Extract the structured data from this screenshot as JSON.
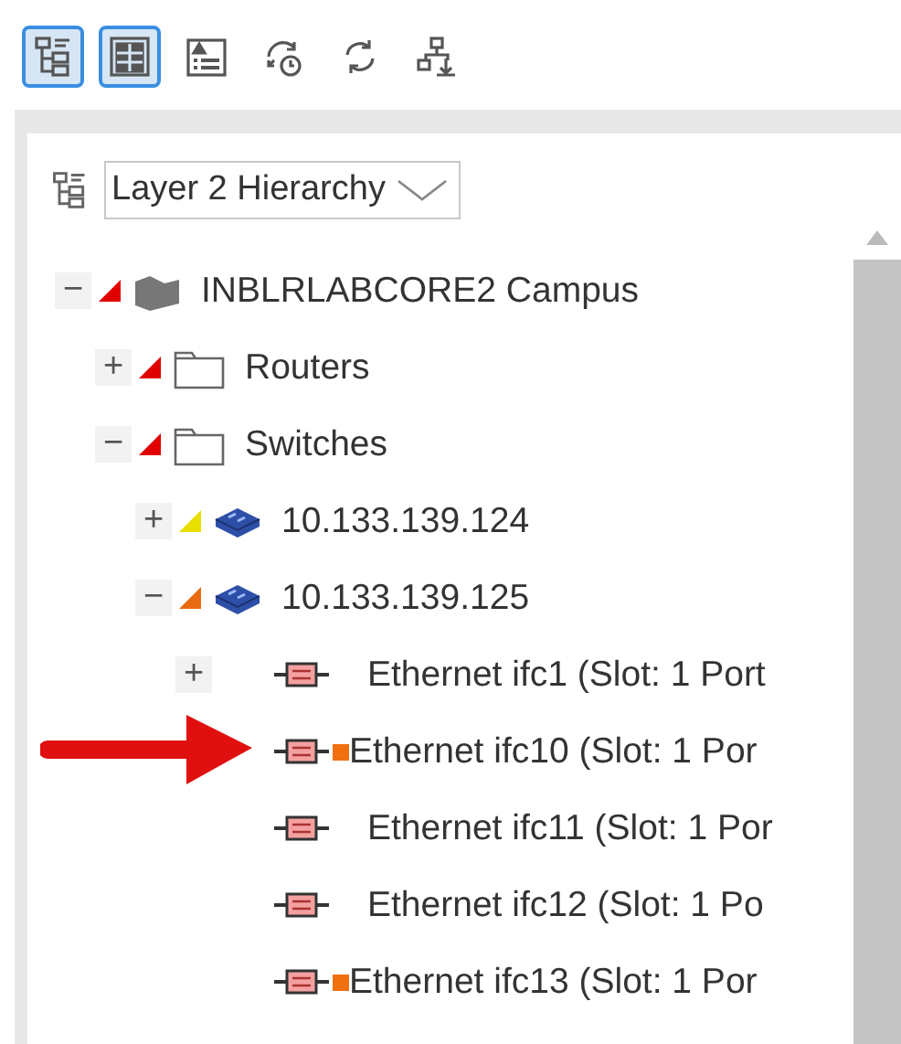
{
  "toolbar": [
    {
      "kind": "tree",
      "selected": true
    },
    {
      "kind": "grid",
      "selected": true
    },
    {
      "kind": "details",
      "selected": false
    },
    {
      "kind": "history",
      "selected": false
    },
    {
      "kind": "refresh",
      "selected": false
    },
    {
      "kind": "export",
      "selected": false
    }
  ],
  "view_selector": {
    "value": "Layer 2 Hierarchy"
  },
  "tree": [
    {
      "kind": "campus",
      "toggle": "−",
      "color": "#e00000",
      "label": "INBLRLABCORE2 Campus",
      "children": [
        {
          "kind": "folder",
          "toggle": "+",
          "color": "#e00000",
          "label": "Routers"
        },
        {
          "kind": "folder",
          "toggle": "−",
          "color": "#e00000",
          "label": "Switches",
          "children": [
            {
              "kind": "switch",
              "toggle": "+",
              "color": "#e8e000",
              "label": "10.133.139.124"
            },
            {
              "kind": "switch",
              "toggle": "−",
              "color": "#e86a10",
              "label": "10.133.139.125",
              "children": [
                {
                  "kind": "port",
                  "toggle": "+",
                  "alarm": false,
                  "label": "Ethernet ifc1 (Slot: 1 Port"
                },
                {
                  "kind": "port",
                  "alarm": true,
                  "label": "Ethernet ifc10 (Slot: 1 Por"
                },
                {
                  "kind": "port",
                  "alarm": false,
                  "label": "Ethernet ifc11 (Slot: 1 Por"
                },
                {
                  "kind": "port",
                  "alarm": false,
                  "label": "Ethernet ifc12 (Slot: 1 Po"
                },
                {
                  "kind": "port",
                  "alarm": true,
                  "label": "Ethernet ifc13 (Slot: 1 Por"
                }
              ]
            }
          ]
        }
      ]
    }
  ]
}
